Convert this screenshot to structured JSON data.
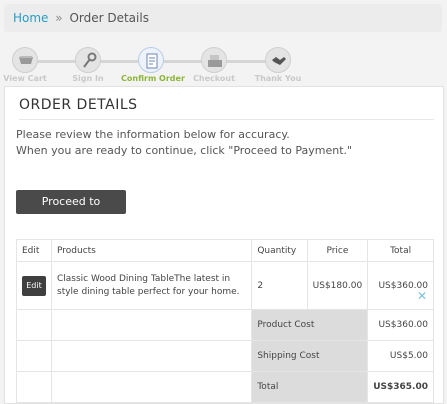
{
  "breadcrumb": {
    "home": "Home",
    "separator": "»",
    "current": "Order Details"
  },
  "steps": [
    {
      "label": "View Cart",
      "icon": "cart-icon",
      "active": false
    },
    {
      "label": "Sign In",
      "icon": "key-icon",
      "active": false
    },
    {
      "label": "Confirm Order",
      "icon": "document-icon",
      "active": true
    },
    {
      "label": "Checkout",
      "icon": "cash-register-icon",
      "active": false
    },
    {
      "label": "Thank You",
      "icon": "handshake-icon",
      "active": false
    }
  ],
  "title": "ORDER DETAILS",
  "intro": {
    "line1": "Please review the information below for accuracy.",
    "line2": "When you are ready to continue, click \"Proceed to Payment.\""
  },
  "pay_button": "Proceed to Payment",
  "table": {
    "headers": {
      "edit": "Edit",
      "products": "Products",
      "quantity": "Quantity",
      "price": "Price",
      "total": "Total"
    },
    "item": {
      "edit_label": "Edit",
      "product": "Classic Wood Dining TableThe latest in style dining table perfect for your home.",
      "quantity": "2",
      "price": "US$180.00",
      "total": "US$360.00"
    },
    "summary": {
      "product_cost_label": "Product Cost",
      "product_cost": "US$360.00",
      "shipping_label": "Shipping Cost",
      "shipping": "US$5.00",
      "total_label": "Total",
      "total": "US$365.00"
    }
  },
  "remove_glyph": "✕"
}
